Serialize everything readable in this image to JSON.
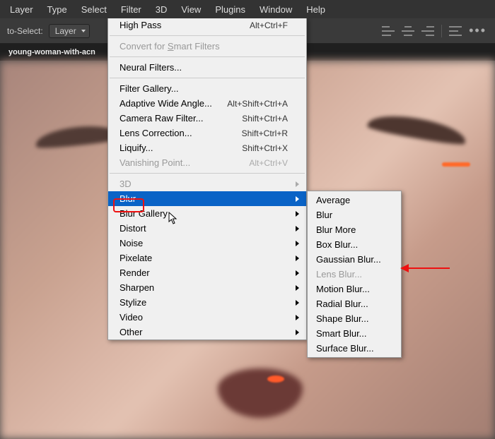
{
  "menubar": {
    "layer": "Layer",
    "type": "Type",
    "select": "Select",
    "filter": "Filter",
    "threeD": "3D",
    "view": "View",
    "plugins": "Plugins",
    "window": "Window",
    "help": "Help"
  },
  "toolbar": {
    "autoSelect": "to-Select:",
    "layerDropdown": "Layer"
  },
  "tab": {
    "name": "young-woman-with-acn"
  },
  "filterMenu": {
    "highPass": "High Pass",
    "highPassKey": "Alt+Ctrl+F",
    "convert": "Convert for Smart Filters",
    "neural": "Neural Filters...",
    "gallery": "Filter Gallery...",
    "awa": "Adaptive Wide Angle...",
    "awaKey": "Alt+Shift+Ctrl+A",
    "craw": "Camera Raw Filter...",
    "crawKey": "Shift+Ctrl+A",
    "lens": "Lens Correction...",
    "lensKey": "Shift+Ctrl+R",
    "liquify": "Liquify...",
    "liquifyKey": "Shift+Ctrl+X",
    "vanish": "Vanishing Point...",
    "vanishKey": "Alt+Ctrl+V",
    "threeD": "3D",
    "blur": "Blur",
    "blurGallery": "Blur Gallery",
    "distort": "Distort",
    "noise": "Noise",
    "pixelate": "Pixelate",
    "render": "Render",
    "sharpen": "Sharpen",
    "stylize": "Stylize",
    "video": "Video",
    "other": "Other"
  },
  "blurSubmenu": {
    "average": "Average",
    "blur": "Blur",
    "blurMore": "Blur More",
    "boxBlur": "Box Blur...",
    "gaussian": "Gaussian Blur...",
    "lensBlur": "Lens Blur...",
    "motion": "Motion Blur...",
    "radial": "Radial Blur...",
    "shape": "Shape Blur...",
    "smart": "Smart Blur...",
    "surface": "Surface Blur..."
  }
}
